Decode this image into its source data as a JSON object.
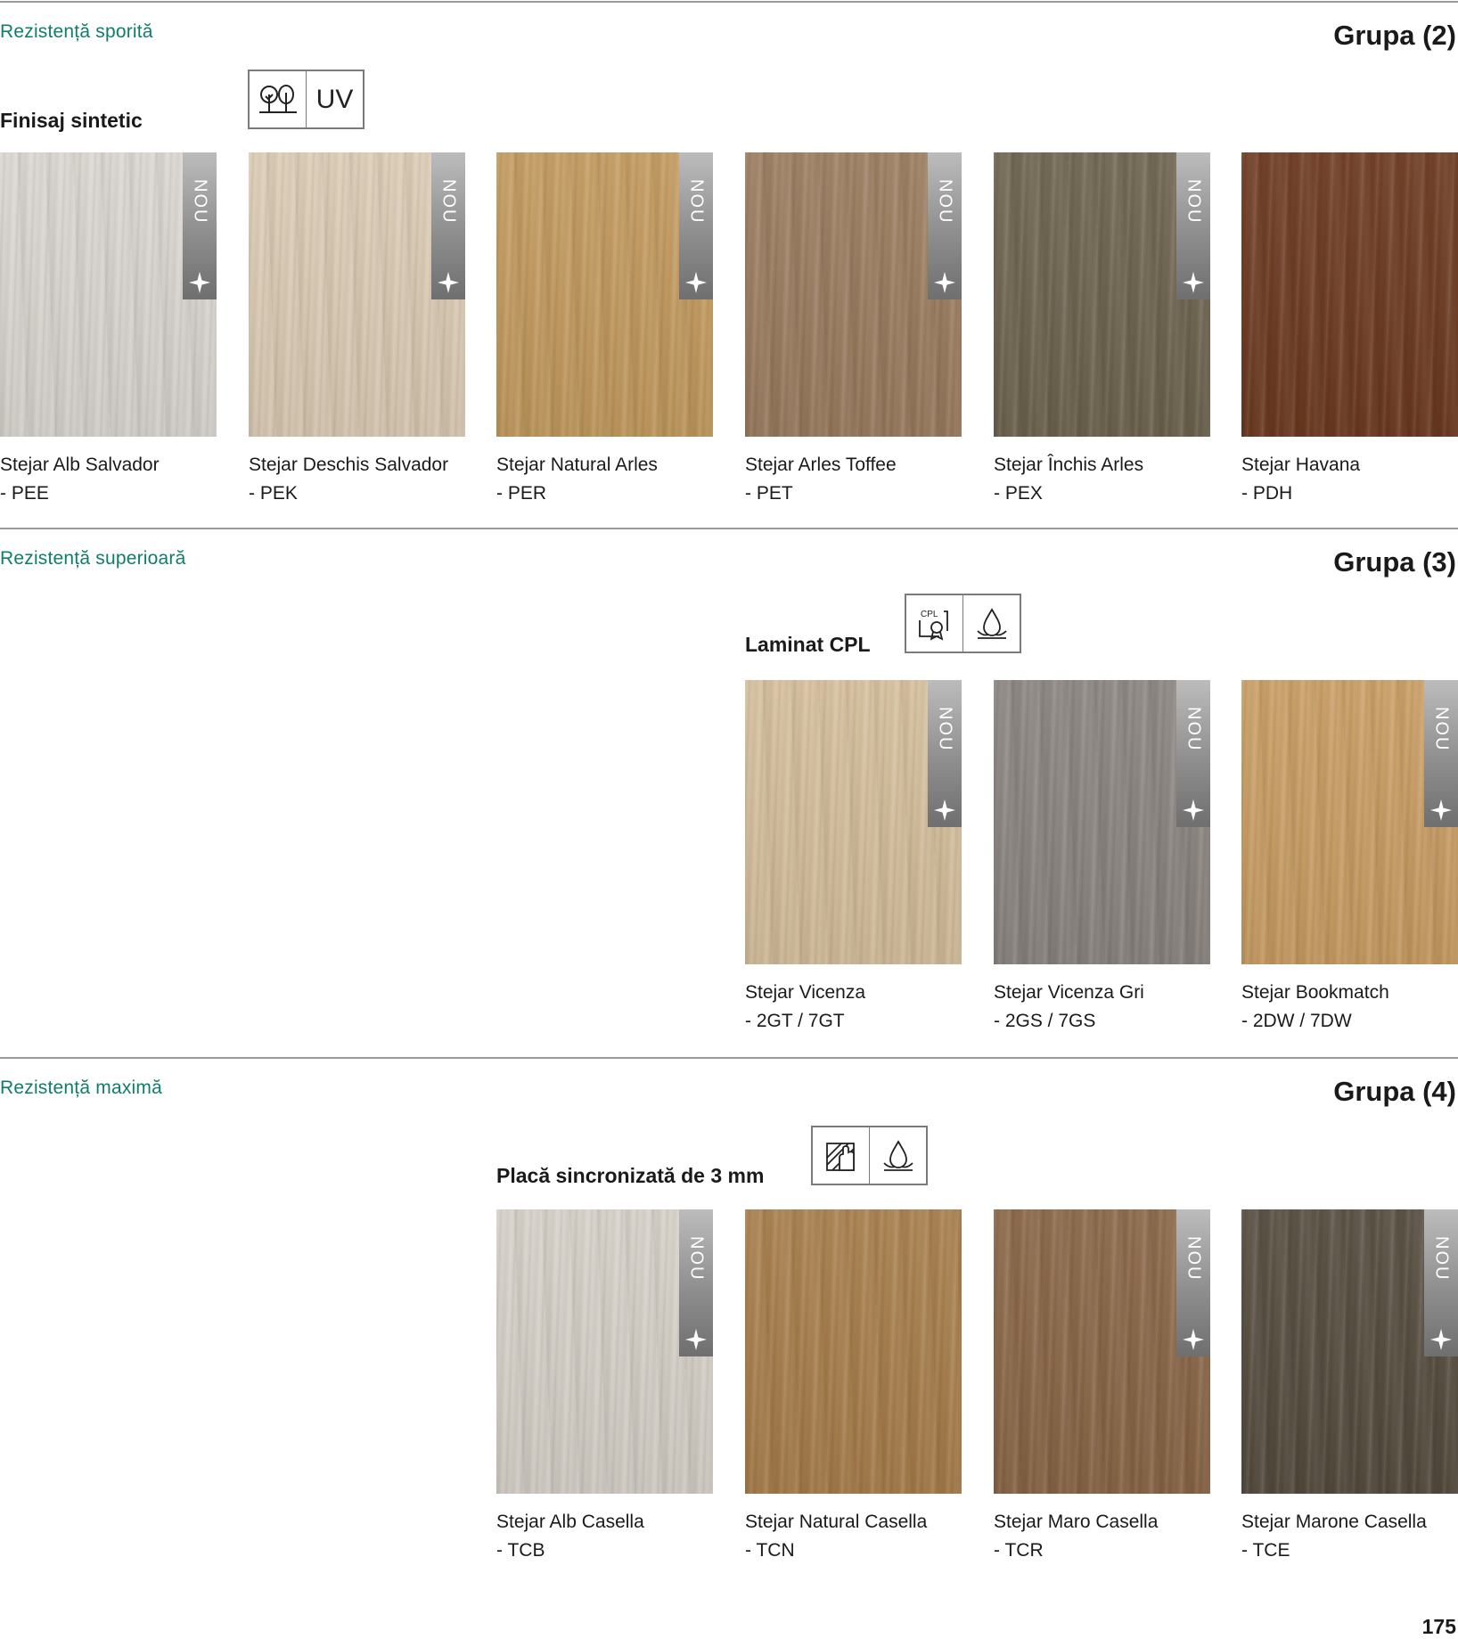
{
  "sections": [
    {
      "resistance": "Rezistență sporită",
      "group": "Grupa (2)",
      "finish": "Finisaj sintetic",
      "icons": [
        "trees-icon",
        "UV"
      ],
      "products": [
        {
          "name": "Stejar Alb Salvador",
          "code": "- PEE",
          "new": true,
          "badge": "NOU",
          "color": "#dad6d0"
        },
        {
          "name": "Stejar Deschis Salvador",
          "code": "- PEK",
          "new": true,
          "badge": "NOU",
          "color": "#dccbb5"
        },
        {
          "name": "Stejar Natural Arles",
          "code": "- PER",
          "new": true,
          "badge": "NOU",
          "color": "#c39a5e"
        },
        {
          "name": "Stejar Arles Toffee",
          "code": "- PET",
          "new": true,
          "badge": "NOU",
          "color": "#9b7c5f"
        },
        {
          "name": "Stejar Închis Arles",
          "code": "- PEX",
          "new": true,
          "badge": "NOU",
          "color": "#6e634f"
        },
        {
          "name": "Stejar Havana",
          "code": "- PDH",
          "new": false,
          "color": "#6d3a20"
        }
      ]
    },
    {
      "resistance": "Rezistență superioară",
      "group": "Grupa (3)",
      "finish": "Laminat CPL",
      "icons": [
        "cpl-certificate-icon",
        "water-drop-icon"
      ],
      "cpl_label": "CPL",
      "products": [
        {
          "name": "Stejar Vicenza",
          "code": "- 2GT / 7GT",
          "new": true,
          "badge": "NOU",
          "color": "#d5bf9c"
        },
        {
          "name": "Stejar Vicenza Gri",
          "code": "- 2GS / 7GS",
          "new": true,
          "badge": "NOU",
          "color": "#8b8480"
        },
        {
          "name": "Stejar Bookmatch",
          "code": "- 2DW / 7DW",
          "new": true,
          "badge": "NOU",
          "color": "#c99d63"
        }
      ]
    },
    {
      "resistance": "Rezistență maximă",
      "group": "Grupa (4)",
      "finish": "Placă sincronizată de 3 mm",
      "icons": [
        "sync-texture-icon",
        "water-drop-icon"
      ],
      "products": [
        {
          "name": "Stejar Alb Casella",
          "code": "- TCB",
          "new": true,
          "badge": "NOU",
          "color": "#d6d0c8"
        },
        {
          "name": "Stejar Natural Casella",
          "code": "- TCN",
          "new": false,
          "color": "#a87e4b"
        },
        {
          "name": "Stejar Maro Casella",
          "code": "- TCR",
          "new": true,
          "badge": "NOU",
          "color": "#8a6646"
        },
        {
          "name": "Stejar Marone Casella",
          "code": "- TCE",
          "new": true,
          "badge": "NOU",
          "color": "#554c3e"
        }
      ]
    }
  ],
  "page_number": "175"
}
